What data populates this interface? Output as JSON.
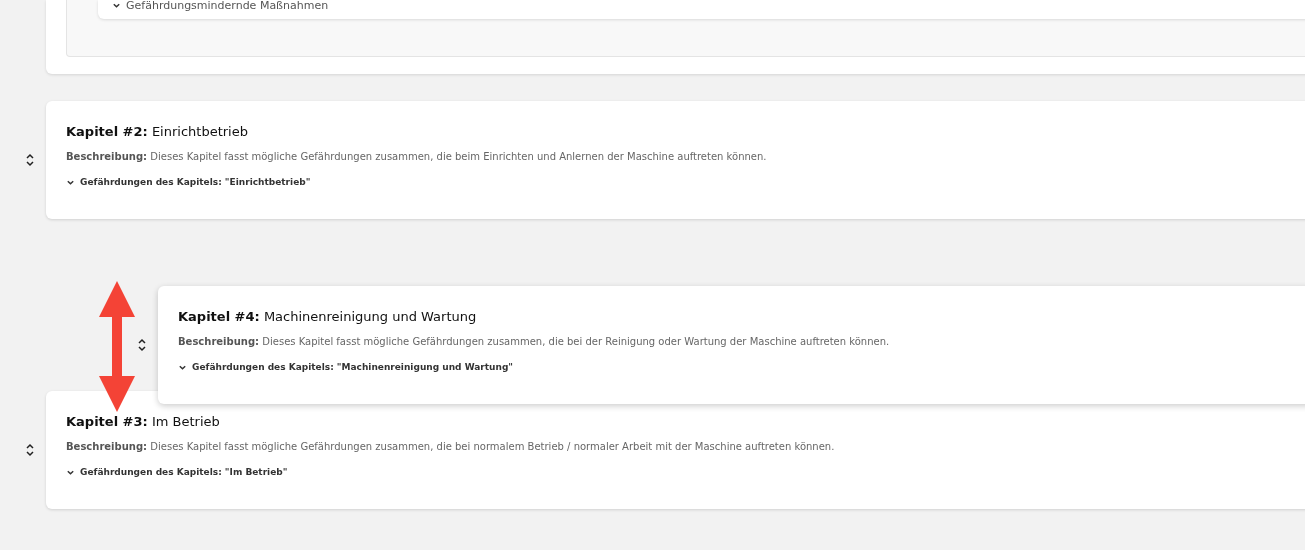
{
  "top_card": {
    "subsection_label": "Gefährdungsmindernde Maßnahmen"
  },
  "chapters": [
    {
      "heading": "**Kapitel #2:** Einrichtbetrieb",
      "description": "**Beschreibung:** Dieses Kapitel fasst mögliche Gefährdungen zusammen, die beim Einrichten und Anlernen der Maschine auftreten können.",
      "hazards_label": "Gefährdungen des Kapitels: \"Einrichtbetrieb\"",
      "dragging": false
    },
    {
      "heading": "**Kapitel #4:** Machinenreinigung und Wartung",
      "description": "**Beschreibung:** Dieses Kapitel fasst mögliche Gefährdungen zusammen, die bei der Reinigung oder Wartung der Maschine auftreten können.",
      "hazards_label": "Gefährdungen des Kapitels: \"Machinenreinigung und Wartung\"",
      "dragging": true
    },
    {
      "heading": "**Kapitel #3:** Im Betrieb",
      "description": "**Beschreibung:** Dieses Kapitel fasst mögliche Gefährdungen zusammen, die bei normalem Betrieb / normaler Arbeit mit der Maschine auftreten können.",
      "hazards_label": "Gefährdungen des Kapitels: \"Im Betrieb\"",
      "dragging": false
    }
  ]
}
